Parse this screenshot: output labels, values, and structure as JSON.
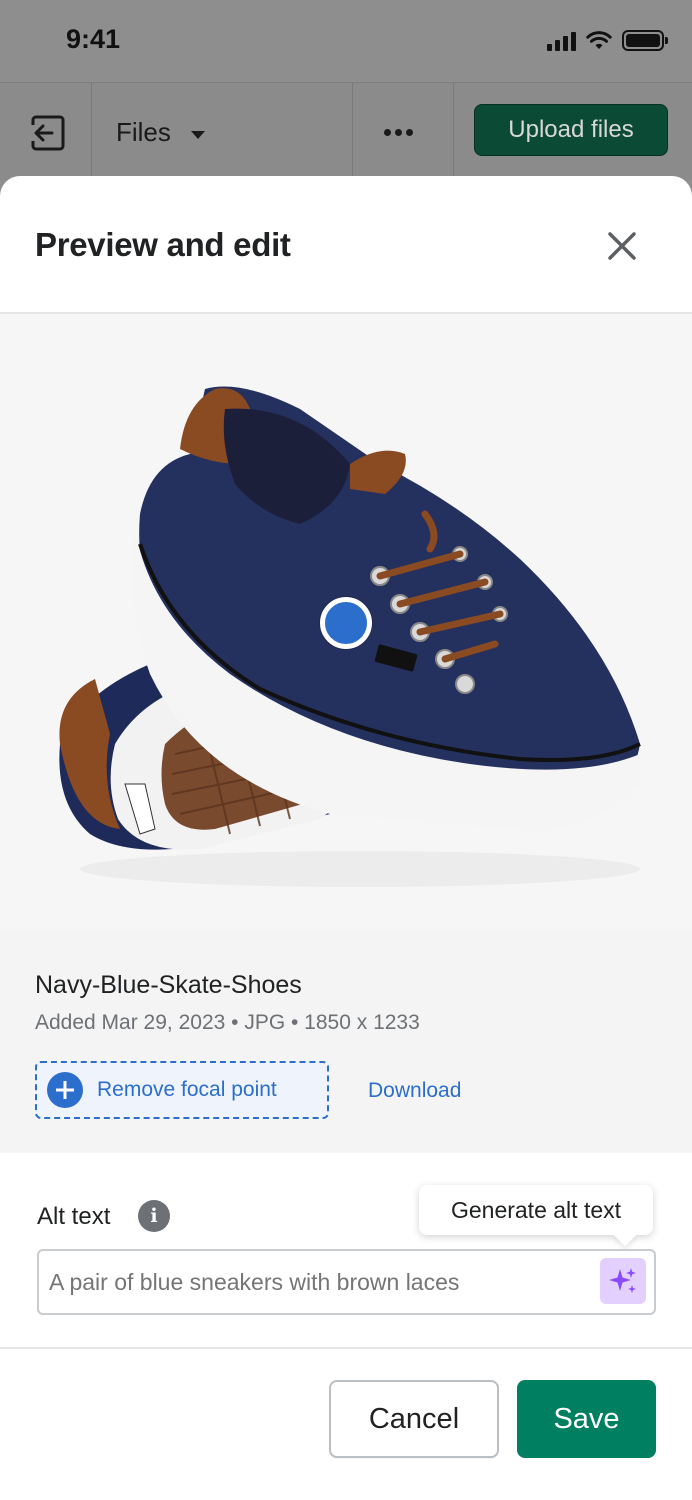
{
  "status_bar": {
    "time": "9:41"
  },
  "app_bar": {
    "files_label": "Files",
    "upload_label": "Upload files"
  },
  "modal": {
    "title": "Preview and edit",
    "image": {
      "alt": "Navy blue skate shoes with brown laces"
    },
    "file": {
      "name": "Navy-Blue-Skate-Shoes",
      "meta": "Added Mar 29, 2023 • JPG • 1850 x 1233"
    },
    "actions": {
      "focal_point_label": "Remove focal point",
      "download_label": "Download"
    },
    "alt_text": {
      "label": "Alt text",
      "info_glyph": "i",
      "tooltip": "Generate alt text",
      "placeholder": "A pair of blue sneakers with brown laces"
    },
    "footer": {
      "cancel_label": "Cancel",
      "save_label": "Save"
    }
  },
  "colors": {
    "primary_green": "#008060",
    "link_blue": "#2c6ecb",
    "sparkle_purple": "#8a4bff"
  }
}
